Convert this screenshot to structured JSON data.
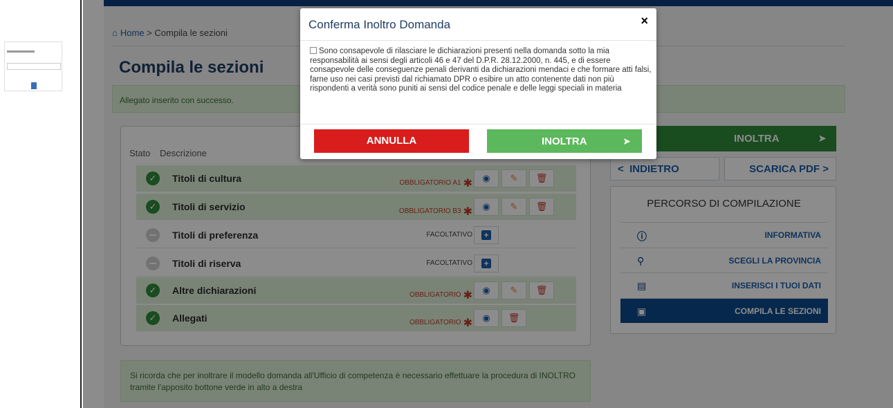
{
  "breadcrumb": {
    "home": "Home",
    "sep": ">",
    "current": "Compila le sezioni"
  },
  "page_title": "Compila le sezioni",
  "alert_success": "Allegato inserito con successo.",
  "table": {
    "headers": {
      "stato": "Stato",
      "descrizione": "Descrizione"
    },
    "rows": [
      {
        "label": "Titoli di cultura",
        "status": "completed",
        "requirement": "OBBLIGATORIO A1",
        "required": true
      },
      {
        "label": "Titoli di servizio",
        "status": "completed",
        "requirement": "OBBLIGATORIO B3",
        "required": true
      },
      {
        "label": "Titoli di preferenza",
        "status": "empty",
        "requirement": "FACOLTATIVO",
        "required": false
      },
      {
        "label": "Titoli di riserva",
        "status": "empty",
        "requirement": "FACOLTATIVO",
        "required": false
      },
      {
        "label": "Altre dichiarazioni",
        "status": "completed",
        "requirement": "OBBLIGATORIO",
        "required": true
      },
      {
        "label": "Allegati",
        "status": "completed",
        "requirement": "OBBLIGATORIO",
        "required": true
      }
    ],
    "required_mark": "✱"
  },
  "note": "Si ricorda che per inoltrare il modello domanda all'Ufficio di competenza è necessario effettuare la procedura di INOLTRO tramite l'apposito bottone verde in alto a destra",
  "actions": {
    "inoltra": "INOLTRA",
    "indietro": "INDIETRO",
    "indietro_chevron": "<",
    "scarica_pdf": "SCARICA PDF",
    "scarica_chevron": ">"
  },
  "path": {
    "title": "PERCORSO DI COMPILAZIONE",
    "items": [
      {
        "label": "INFORMATIVA",
        "icon": "info-icon",
        "active": false
      },
      {
        "label": "SCEGLI LA PROVINCIA",
        "icon": "map-marker-icon",
        "active": false
      },
      {
        "label": "INSERISCI I TUOI DATI",
        "icon": "id-card-icon",
        "active": false
      },
      {
        "label": "COMPILA LE SEZIONI",
        "icon": "briefcase-icon",
        "active": true
      }
    ]
  },
  "modal": {
    "title": "Conferma Inoltro Domanda",
    "close": "×",
    "declaration": "Sono consapevole di rilasciare le dichiarazioni presenti nella domanda sotto la mia responsabilità ai sensi degli articoli 46 e 47 del D.P.R. 28.12.2000, n. 445, e di essere consapevole delle conseguenze penali derivanti da dichiarazioni mendaci e che formare atti falsi, farne uso nei casi previsti dal richiamato DPR o esibire un atto contenente dati non più rispondenti a verità sono puniti ai sensi del codice penale e delle leggi speciali in materia",
    "checkbox_checked": false,
    "annulla": "ANNULLA",
    "inoltra": "INOLTRA"
  },
  "colors": {
    "primary_navy": "#0b3d7a",
    "link_blue": "#1a5ea8",
    "success_green": "#2e8b3a",
    "light_green": "#5cb85c",
    "danger_red": "#d91c1c",
    "success_bg": "#dff0d8"
  }
}
